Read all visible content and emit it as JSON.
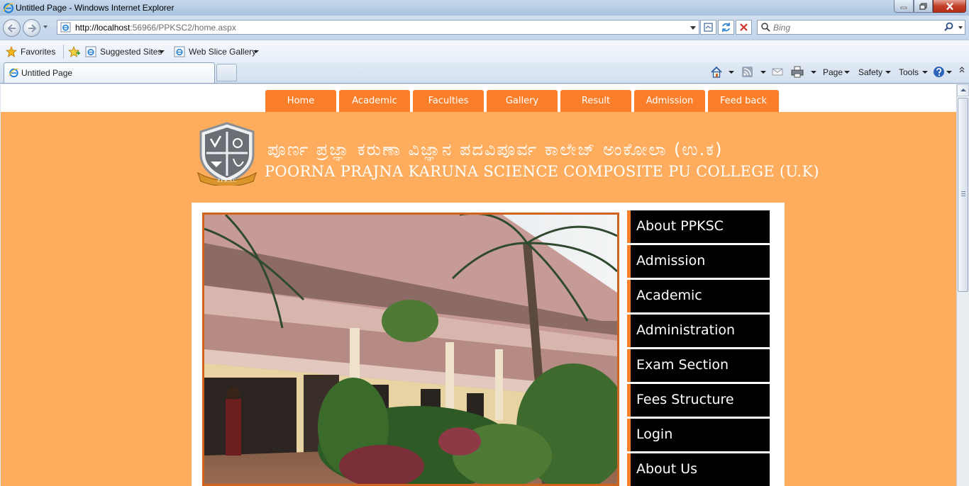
{
  "window": {
    "title": "Untitled Page - Windows Internet Explorer"
  },
  "address_bar": {
    "url_host": "http://localhost",
    "url_rest": ":56966/PPKSC2/home.aspx"
  },
  "search": {
    "placeholder": "Bing"
  },
  "favorites_bar": {
    "favorites_label": "Favorites",
    "items": [
      "Suggested Sites",
      "Web Slice Gallery"
    ]
  },
  "tab": {
    "title": "Untitled Page"
  },
  "command_bar": {
    "page_label": "Page",
    "safety_label": "Safety",
    "tools_label": "Tools"
  },
  "site": {
    "nav": [
      "Home",
      "Academic",
      "Faculties",
      "Gallery",
      "Result",
      "Admission",
      "Feed back"
    ],
    "title_kannada": "ಪೂರ್ಣ ಪ್ರಜ್ಞಾ ಕರುಣಾ ವಿಜ್ಞಾನ ಪದವಿಪೂರ್ವ ಕಾಲೇಜ್ ಅಂಕೋಲಾ (ಉ.ಕ)",
    "title_english": "POORNA PRAJNA KARUNA SCIENCE COMPOSITE PU COLLEGE (U.K)",
    "logo_text": "P.P.K.S.C",
    "side_menu": [
      "About PPKSC",
      "Admission",
      "Academic",
      "Administration",
      "Exam Section",
      "Fees Structure",
      "Login",
      "About Us"
    ]
  },
  "colors": {
    "brand_orange": "#fb7f2a",
    "page_background": "#fead5e",
    "menu_background": "#000000"
  }
}
